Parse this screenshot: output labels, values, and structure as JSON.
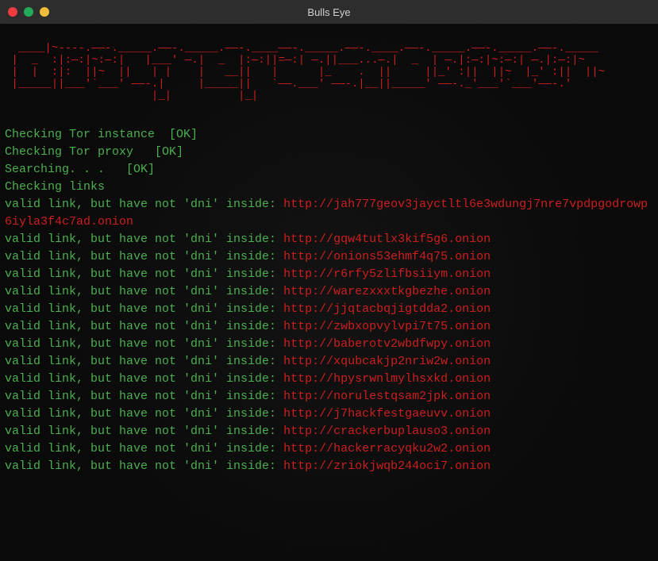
{
  "window": {
    "title": "Bulls Eye"
  },
  "ascii_art": "  ____|~----.——-._____.——-._____.——-.____——-._____.——-.____.——-._____.——-._____.——-._____  \n |  _  :|:—:|~:—:|   |___' —.|  _  |:—:||=—:| —.||___...—.|  _  | —.|:—:|~:—:| —.|:—:|~ \n |  |  :|:  ||~  ||   | |    |   __||   |      |_    .  ||     ||_' :||  ||~  |_' :||  ||~\n |_____||___'`___' ——-.|     |_____||   `——.___' ——-.|__||_____' ——-._'___'`___'——-.' \n                      |_|          |_|                                          ",
  "checks": [
    {
      "label": "Checking Tor instance  ",
      "status": "[OK]"
    },
    {
      "label": "Checking Tor proxy   ",
      "status": "[OK]"
    },
    {
      "label": "Searching. . .   ",
      "status": "[OK]"
    },
    {
      "label": "Checking links",
      "status": ""
    }
  ],
  "valid_prefix": "valid link, but have not 'dni' inside: ",
  "links": [
    "http://jah777geov3jayctltl6e3wdungj7nre7vpdpgodrowp6iyla3f4c7ad.onion",
    "http://gqw4tutlx3kif5g6.onion",
    "http://onions53ehmf4q75.onion",
    "http://r6rfy5zlifbsiiym.onion",
    "http://warezxxxtkgbezhe.onion",
    "http://jjqtacbqjigtdda2.onion",
    "http://zwbxopvylvpi7t75.onion",
    "http://baberotv2wbdfwpy.onion",
    "http://xqubcakjp2nriw2w.onion",
    "http://hpysrwnlmylhsxkd.onion",
    "http://norulestqsam2jpk.onion",
    "http://j7hackfestgaeuvv.onion",
    "http://crackerbuplauso3.onion",
    "http://hackerracyqku2w2.onion",
    "http://zriokjwqb244oci7.onion"
  ]
}
